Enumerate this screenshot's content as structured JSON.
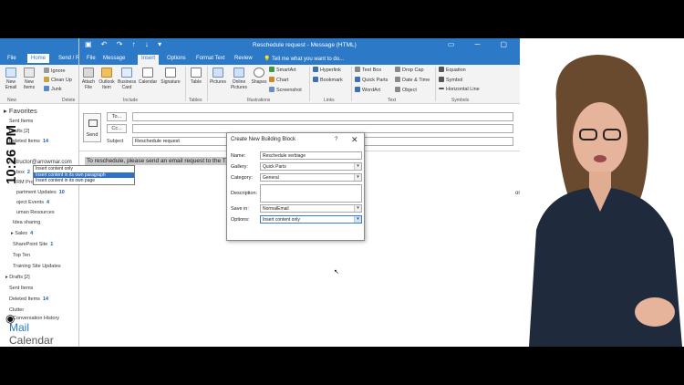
{
  "clock": "10:26 PM",
  "back_window": {
    "tabs": [
      "File",
      "Home",
      "Send / R"
    ],
    "active_tab": "Home",
    "ribbon": {
      "new_email": "New Email",
      "new_items": "New Items",
      "ignore": "Ignore",
      "clean_up": "Clean Up",
      "junk": "Junk",
      "group_new": "New",
      "group_delete": "Delete"
    },
    "favorites_label": "Favorites",
    "favorites": [
      {
        "label": "Sent Items",
        "count": ""
      },
      {
        "label": "Drafts [2]",
        "count": ""
      },
      {
        "label": "Deleted Items",
        "count": "14"
      }
    ],
    "account": "instructor@arrowmar.com",
    "folders": [
      {
        "label": "box",
        "count": "2"
      },
      {
        "label": "RM Project",
        "count": ""
      },
      {
        "label": "partment Updates",
        "count": "10"
      },
      {
        "label": "oject Events",
        "count": "4"
      },
      {
        "label": "uman Resources",
        "count": ""
      },
      {
        "label": "Idea sharing",
        "count": ""
      },
      {
        "label": "Sales",
        "count": "4"
      },
      {
        "label": "SharePoint Site",
        "count": "1"
      },
      {
        "label": "Top Ten",
        "count": ""
      },
      {
        "label": "Training Site Updates",
        "count": ""
      },
      {
        "label": "Drafts [2]",
        "count": ""
      },
      {
        "label": "Sent Items",
        "count": ""
      },
      {
        "label": "Deleted Items",
        "count": "14"
      },
      {
        "label": "Clutter",
        "count": ""
      },
      {
        "label": "Conversation History",
        "count": ""
      }
    ],
    "bottom_nav": [
      "Mail",
      "Calendar"
    ]
  },
  "message_window": {
    "title": "Reschedule request - Message (HTML)",
    "tabs": [
      "File",
      "Message",
      "Insert",
      "Options",
      "Format Text",
      "Review"
    ],
    "active_tab": "Insert",
    "tell_me": "Tell me what you want to do...",
    "ribbon": {
      "attach_file": "Attach File",
      "outlook_item": "Outlook Item",
      "business_card": "Business Card",
      "calendar": "Calendar",
      "signature": "Signature",
      "table": "Table",
      "pictures": "Pictures",
      "online_pictures": "Online Pictures",
      "shapes": "Shapes",
      "smartart": "SmartArt",
      "chart": "Chart",
      "screenshot": "Screenshot",
      "hyperlink": "Hyperlink",
      "bookmark": "Bookmark",
      "text_box": "Text Box",
      "quick_parts": "Quick Parts",
      "wordart": "WordArt",
      "drop_cap": "Drop Cap",
      "date_time": "Date & Time",
      "object": "Object",
      "equation": "Equation",
      "symbol": "Symbol",
      "horizontal_line": "Horizontal Line",
      "groups": [
        "Include",
        "Tables",
        "Illustrations",
        "Links",
        "Text",
        "Symbols"
      ]
    },
    "send": "Send",
    "to": "To...",
    "cc": "Cc...",
    "subject_label": "Subject",
    "subject_value": "Reschedule request",
    "body_text": "To reschedule, please send an email request to the Trai",
    "body_fragment": "or"
  },
  "dialog": {
    "title": "Create New Building Block",
    "help": "?",
    "name_label": "Name:",
    "name_value": "Reschedule verbiage",
    "gallery_label": "Gallery:",
    "gallery_value": "Quick Parts",
    "category_label": "Category:",
    "category_value": "General",
    "description_label": "Description:",
    "save_in_label": "Save in:",
    "save_in_value": "NormalEmail",
    "options_label": "Options:",
    "options_value": "Insert content only",
    "options_list": [
      "Insert content only",
      "Insert content in its own paragraph",
      "Insert content in its own page"
    ],
    "options_selected_index": 1
  },
  "colors": {
    "accent": "#2b79c7",
    "selection": "#2f70c8",
    "presenter_shirt": "#1f2a3c"
  }
}
